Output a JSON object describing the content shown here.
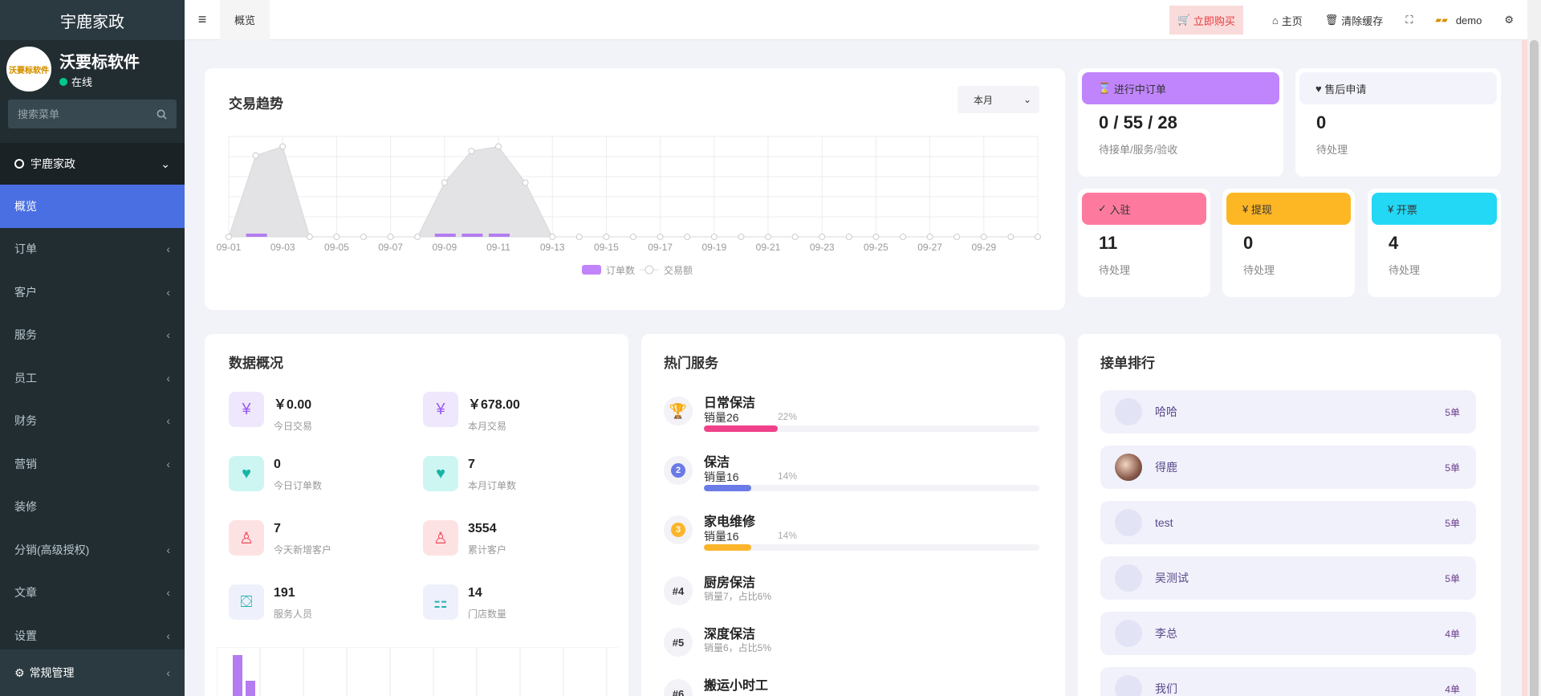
{
  "sidebar": {
    "brand": "宇鹿家政",
    "user_name": "沃要标软件",
    "user_status": "在线",
    "logo_text": "沃要标软件",
    "search_placeholder": "搜索菜单",
    "group_label": "宇鹿家政",
    "items": [
      {
        "label": "概览",
        "active": true,
        "has_children": false
      },
      {
        "label": "订单",
        "active": false,
        "has_children": true
      },
      {
        "label": "客户",
        "active": false,
        "has_children": true
      },
      {
        "label": "服务",
        "active": false,
        "has_children": true
      },
      {
        "label": "员工",
        "active": false,
        "has_children": true
      },
      {
        "label": "财务",
        "active": false,
        "has_children": true
      },
      {
        "label": "营销",
        "active": false,
        "has_children": true
      },
      {
        "label": "装修",
        "active": false,
        "has_children": false
      },
      {
        "label": "分销(高级授权)",
        "active": false,
        "has_children": true
      },
      {
        "label": "文章",
        "active": false,
        "has_children": true
      },
      {
        "label": "设置",
        "active": false,
        "has_children": true
      }
    ],
    "bottom_label": "常规管理"
  },
  "topbar": {
    "tab_label": "概览",
    "buy_label": "立即购买",
    "home_label": "主页",
    "clear_cache_label": "清除缓存",
    "user_label": "demo"
  },
  "trend": {
    "title": "交易趋势",
    "period_selected": "本月",
    "legend_orders": "订单数",
    "legend_amount": "交易额"
  },
  "chart_data": {
    "type": "bar",
    "x_labels": [
      "09-01",
      "09-03",
      "09-05",
      "09-07",
      "09-09",
      "09-11",
      "09-13",
      "09-15",
      "09-17",
      "09-19",
      "09-21",
      "09-23",
      "09-25",
      "09-27",
      "09-29"
    ],
    "series": [
      {
        "name": "订单数",
        "values": [
          0,
          1,
          0,
          0,
          0,
          0,
          0,
          0,
          1,
          1,
          1,
          0,
          0,
          0,
          0,
          0,
          0,
          0,
          0,
          0,
          0,
          0,
          0,
          0,
          0,
          0,
          0,
          0,
          0,
          0
        ]
      },
      {
        "name": "交易额",
        "values": [
          0,
          0.9,
          1,
          0,
          0,
          0,
          0,
          0,
          0.6,
          0.95,
          1,
          0.6,
          0,
          0,
          0,
          0,
          0,
          0,
          0,
          0,
          0,
          0,
          0,
          0,
          0,
          0,
          0,
          0,
          0,
          0
        ]
      }
    ],
    "grid": true,
    "legend": "bottom-center"
  },
  "stats": {
    "in_progress": {
      "title": "进行中订单",
      "value": "0 / 55 / 28",
      "sub": "待接单/服务/验收",
      "color": "#c084fc"
    },
    "after_sales": {
      "title": "售后申请",
      "value": "0",
      "sub": "待处理",
      "color": "#f3f3fc"
    },
    "settle": {
      "title": "入驻",
      "value": "11",
      "sub": "待处理",
      "color": "#fd7a9e"
    },
    "withdraw": {
      "title": "提现",
      "value": "0",
      "sub": "待处理",
      "color": "#fdb624"
    },
    "invoice": {
      "title": "开票",
      "value": "4",
      "sub": "待处理",
      "color": "#22d8f5"
    }
  },
  "overview": {
    "title": "数据概况",
    "items": [
      {
        "value": "￥0.00",
        "label": "今日交易",
        "icon": "yuan-icon"
      },
      {
        "value": "￥678.00",
        "label": "本月交易",
        "icon": "yuan-icon"
      },
      {
        "value": "0",
        "label": "今日订单数",
        "icon": "heart-icon"
      },
      {
        "value": "7",
        "label": "本月订单数",
        "icon": "heart-icon"
      },
      {
        "value": "7",
        "label": "今天新增客户",
        "icon": "user-icon"
      },
      {
        "value": "3554",
        "label": "累计客户",
        "icon": "user-icon"
      },
      {
        "value": "191",
        "label": "服务人员",
        "icon": "bag-icon"
      },
      {
        "value": "14",
        "label": "门店数量",
        "icon": "grid-icon"
      }
    ]
  },
  "hot_services": {
    "title": "热门服务",
    "items": [
      {
        "rank": "trophy",
        "name": "日常保洁",
        "sales": "销量26",
        "pct": "22%",
        "percent": 22,
        "color": "#f0428a"
      },
      {
        "rank": "2",
        "name": "保洁",
        "sales": "销量16",
        "pct": "14%",
        "percent": 14,
        "color": "#6a7be8"
      },
      {
        "rank": "3",
        "name": "家电维修",
        "sales": "销量16",
        "pct": "14%",
        "percent": 14,
        "color": "#fbb52a"
      },
      {
        "rank": "#4",
        "name": "厨房保洁",
        "sales": "销量7，占比6%"
      },
      {
        "rank": "#5",
        "name": "深度保洁",
        "sales": "销量6，占比5%"
      },
      {
        "rank": "#6",
        "name": "搬运小时工",
        "sales": ""
      }
    ]
  },
  "ranking": {
    "title": "接单排行",
    "items": [
      {
        "name": "哈哈",
        "count": "5单"
      },
      {
        "name": "得鹿",
        "count": "5单"
      },
      {
        "name": "test",
        "count": "5单"
      },
      {
        "name": "吴测试",
        "count": "5单"
      },
      {
        "name": "李总",
        "count": "4单"
      },
      {
        "name": "我们",
        "count": "4单"
      }
    ]
  }
}
